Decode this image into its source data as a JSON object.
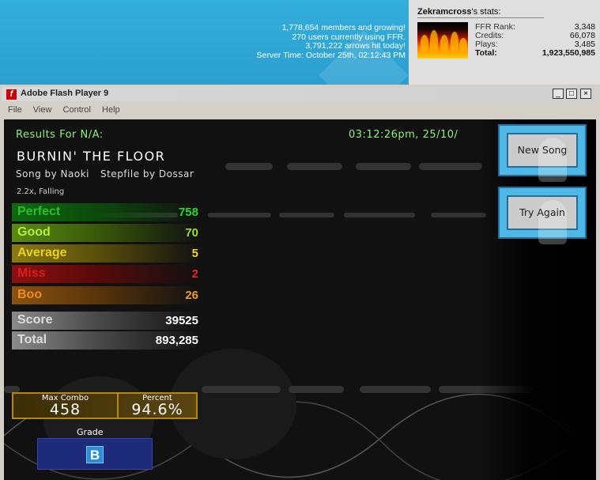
{
  "site": {
    "stats_lines": [
      "1,778,654 members and growing!",
      "270 users currently using FFR.",
      "3,791,222 arrows hit today!",
      "Server Time: October 25th, 02:12:43 PM"
    ]
  },
  "user_panel": {
    "username": "Zekramcross",
    "title_suffix": "'s stats:",
    "rows": [
      {
        "label": "FFR Rank:",
        "value": "3,348"
      },
      {
        "label": "Credits:",
        "value": "66,078"
      },
      {
        "label": "Plays:",
        "value": "3,485"
      },
      {
        "label": "Total:",
        "value": "1,923,550,985"
      }
    ]
  },
  "window": {
    "title": "Adobe Flash Player 9",
    "controls": [
      "_",
      "□",
      "×"
    ],
    "menu": [
      "File",
      "View",
      "Control",
      "Help"
    ]
  },
  "results": {
    "header": "Results For N/A:",
    "timestamp": "03:12:26pm, 25/10/",
    "song_title": "BURNIN' THE FLOOR",
    "song_by": "Song by Naoki",
    "stepfile_by": "Stepfile by Dossar",
    "speed": "2.2x, Falling",
    "judgements": [
      {
        "label": "Perfect",
        "value": "758",
        "color": "#2bbf2b"
      },
      {
        "label": "Good",
        "value": "70",
        "color": "#9be21f"
      },
      {
        "label": "Average",
        "value": "5",
        "color": "#e8d21a"
      },
      {
        "label": "Miss",
        "value": "2",
        "color": "#e01a1a"
      },
      {
        "label": "Boo",
        "value": "26",
        "color": "#f08a1a"
      }
    ],
    "score_label": "Score",
    "score": "39525",
    "total_label": "Total",
    "total": "893,285",
    "max_combo_label": "Max Combo",
    "max_combo": "458",
    "percent_label": "Percent",
    "percent": "94.6%",
    "grade_label": "Grade",
    "grade": "B"
  },
  "buttons": {
    "new_song": "New Song",
    "try_again": "Try Again"
  }
}
